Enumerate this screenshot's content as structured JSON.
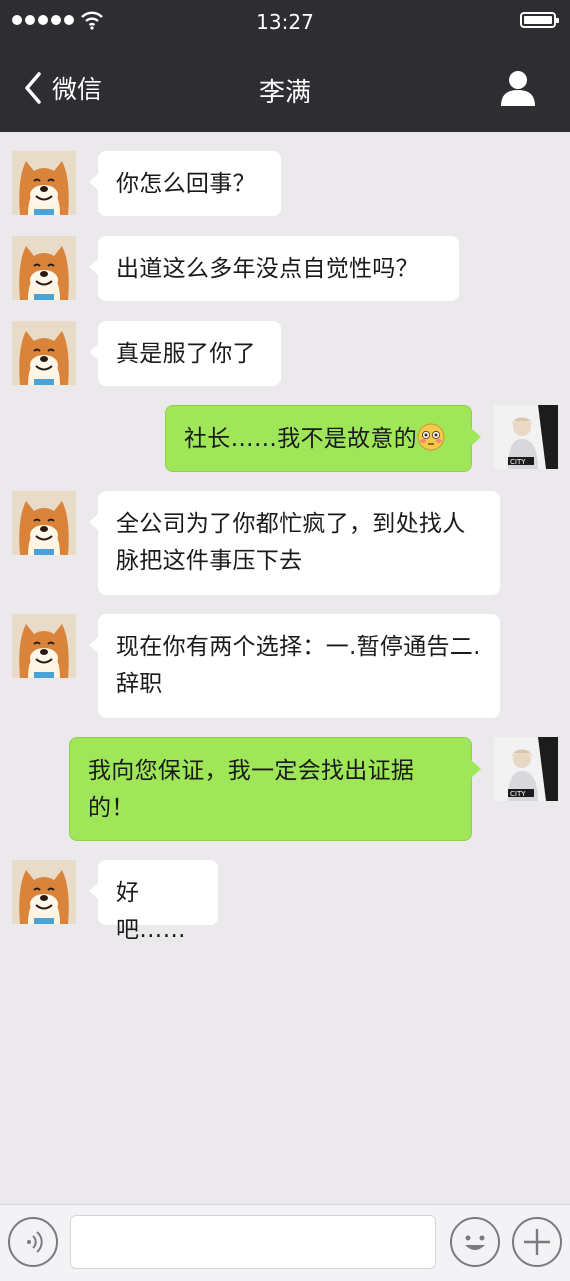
{
  "status_bar": {
    "time": "13:27"
  },
  "nav": {
    "back_label": "微信",
    "title": "李满"
  },
  "messages": [
    {
      "side": "in",
      "text": "你怎么回事？"
    },
    {
      "side": "in",
      "text": "出道这么多年没点自觉性吗？"
    },
    {
      "side": "in",
      "text": "真是服了你了"
    },
    {
      "side": "out",
      "text": "社长……我不是故意的",
      "emoji": "flushed-face-emoji"
    },
    {
      "side": "in",
      "text": "全公司为了你都忙疯了，到处找人脉把这件事压下去"
    },
    {
      "side": "in",
      "text": "现在你有两个选择：一.暂停通告二.辞职"
    },
    {
      "side": "out",
      "text": "我向您保证，我一定会找出证据的！"
    },
    {
      "side": "in",
      "text": "好吧……"
    }
  ],
  "input_bar": {
    "text_value": ""
  },
  "colors": {
    "nav_bg": "#2e2d32",
    "chat_bg": "#ece9ed",
    "outgoing_bubble": "#9fe658",
    "incoming_bubble": "#ffffff"
  },
  "icons": [
    "back-chevron-icon",
    "profile-icon",
    "wifi-icon",
    "battery-icon",
    "voice-icon",
    "emoji-icon",
    "plus-icon"
  ]
}
